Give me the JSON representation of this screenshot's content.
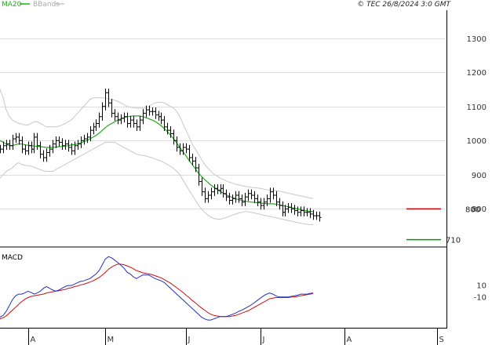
{
  "header": {
    "legend_ma": "MA20",
    "legend_bb": "BBands",
    "copyright": "© TEC 26/8/2024 3:0 GMT"
  },
  "colors": {
    "ma": "#22aa22",
    "bands": "#c8c8c8",
    "price": "#000000",
    "macd": "#2233bb",
    "signal": "#cc1111",
    "resistance": "#cc0000",
    "support": "#009900",
    "grid": "#dddddd",
    "axis": "#000000"
  },
  "chart_data": [
    {
      "type": "line",
      "panel": "price",
      "title": "",
      "ylabels": [
        "1300",
        "1200",
        "1100",
        "1000",
        "900",
        "800"
      ],
      "yticks": [
        1300,
        1200,
        1100,
        1000,
        900,
        800
      ],
      "ylim": [
        700,
        1370
      ],
      "xlim": [
        0,
        143
      ],
      "month_labels": [
        {
          "label": "A",
          "x": 9
        },
        {
          "label": "M",
          "x": 34
        },
        {
          "label": "J",
          "x": 60
        },
        {
          "label": "J",
          "x": 84
        },
        {
          "label": "A",
          "x": 111
        },
        {
          "label": "S",
          "x": 141
        }
      ],
      "close": [
        975,
        985,
        990,
        985,
        1005,
        1010,
        1000,
        975,
        970,
        985,
        975,
        1010,
        985,
        960,
        950,
        965,
        975,
        990,
        1000,
        995,
        985,
        990,
        980,
        970,
        985,
        990,
        1000,
        1005,
        1010,
        1030,
        1040,
        1050,
        1070,
        1100,
        1140,
        1110,
        1080,
        1070,
        1060,
        1065,
        1070,
        1050,
        1060,
        1050,
        1040,
        1060,
        1080,
        1090,
        1085,
        1085,
        1075,
        1070,
        1060,
        1040,
        1030,
        1020,
        1000,
        980,
        970,
        980,
        975,
        950,
        940,
        920,
        880,
        850,
        830,
        840,
        850,
        860,
        855,
        860,
        845,
        835,
        825,
        830,
        840,
        830,
        820,
        835,
        845,
        840,
        830,
        820,
        810,
        820,
        830,
        850,
        840,
        820,
        810,
        790,
        800,
        805,
        800,
        795,
        790,
        795,
        790,
        790,
        785,
        780,
        780,
        775
      ],
      "ma20": [
        1000,
        995,
        990,
        985,
        985,
        988,
        990,
        990,
        988,
        986,
        985,
        984,
        983,
        982,
        981,
        980,
        980,
        980,
        981,
        982,
        983,
        984,
        985,
        987,
        988,
        990,
        993,
        997,
        1000,
        1005,
        1010,
        1015,
        1022,
        1030,
        1038,
        1045,
        1050,
        1055,
        1060,
        1064,
        1067,
        1070,
        1071,
        1072,
        1072,
        1072,
        1070,
        1067,
        1064,
        1060,
        1056,
        1050,
        1043,
        1035,
        1026,
        1016,
        1005,
        993,
        980,
        968,
        955,
        942,
        930,
        918,
        905,
        895,
        886,
        878,
        870,
        863,
        857,
        851,
        846,
        841,
        837,
        833,
        830,
        827,
        825,
        823,
        821,
        820,
        819,
        818,
        817,
        816,
        815,
        815,
        815,
        814,
        812,
        810,
        808,
        806,
        804,
        802,
        800,
        798,
        796,
        794,
        793,
        792
      ],
      "bb_upper": [
        1150,
        1125,
        1090,
        1070,
        1060,
        1055,
        1050,
        1048,
        1046,
        1045,
        1050,
        1055,
        1055,
        1050,
        1045,
        1040,
        1040,
        1040,
        1040,
        1042,
        1045,
        1050,
        1055,
        1060,
        1070,
        1080,
        1090,
        1100,
        1110,
        1120,
        1125,
        1125,
        1125,
        1125,
        1125,
        1122,
        1120,
        1118,
        1115,
        1110,
        1105,
        1100,
        1098,
        1096,
        1095,
        1095,
        1095,
        1095,
        1100,
        1105,
        1110,
        1112,
        1112,
        1110,
        1105,
        1100,
        1095,
        1085,
        1070,
        1050,
        1030,
        1010,
        990,
        975,
        960,
        945,
        930,
        920,
        910,
        902,
        896,
        890,
        886,
        882,
        878,
        875,
        872,
        870,
        868,
        866,
        865,
        863,
        862,
        861,
        860,
        858,
        856,
        855,
        854,
        853,
        852,
        850,
        848,
        846,
        844,
        842,
        840,
        838,
        836,
        834,
        832,
        830
      ],
      "bb_lower": [
        890,
        900,
        910,
        915,
        920,
        930,
        935,
        930,
        928,
        926,
        925,
        922,
        918,
        915,
        912,
        910,
        910,
        910,
        915,
        920,
        925,
        930,
        935,
        940,
        945,
        950,
        955,
        960,
        965,
        970,
        975,
        980,
        985,
        990,
        995,
        995,
        995,
        995,
        990,
        985,
        980,
        975,
        970,
        965,
        960,
        958,
        957,
        955,
        952,
        950,
        946,
        943,
        940,
        935,
        930,
        925,
        918,
        910,
        900,
        885,
        870,
        855,
        840,
        825,
        812,
        800,
        790,
        782,
        776,
        772,
        770,
        770,
        772,
        775,
        778,
        782,
        785,
        788,
        790,
        792,
        792,
        790,
        788,
        786,
        784,
        782,
        780,
        778,
        776,
        774,
        772,
        770,
        768,
        766,
        764,
        762,
        760,
        758,
        756,
        755,
        754,
        754
      ],
      "resistance": 800,
      "support": 710,
      "resistance_label": "800",
      "support_label": "710"
    },
    {
      "type": "line",
      "panel": "macd",
      "title": "MACD",
      "ylabels": [
        "10",
        "-10"
      ],
      "yticks": [
        10,
        -10
      ],
      "ylim": [
        -58,
        70
      ],
      "xlim": [
        0,
        143
      ],
      "macd": [
        -45,
        -42,
        -35,
        -25,
        -15,
        -8,
        -5,
        -5,
        -3,
        0,
        -2,
        -5,
        -3,
        0,
        5,
        8,
        5,
        2,
        0,
        2,
        5,
        8,
        10,
        10,
        12,
        15,
        17,
        18,
        20,
        22,
        26,
        30,
        36,
        46,
        56,
        60,
        58,
        54,
        50,
        45,
        40,
        33,
        30,
        25,
        22,
        25,
        28,
        28,
        28,
        25,
        22,
        20,
        18,
        15,
        10,
        5,
        0,
        -5,
        -10,
        -15,
        -20,
        -25,
        -30,
        -35,
        -40,
        -45,
        -48,
        -50,
        -50,
        -48,
        -46,
        -44,
        -44,
        -44,
        -42,
        -40,
        -38,
        -35,
        -33,
        -30,
        -27,
        -24,
        -20,
        -16,
        -12,
        -8,
        -5,
        -3,
        -5,
        -8,
        -10,
        -10,
        -10,
        -10,
        -9,
        -8,
        -7,
        -5,
        -5,
        -5,
        -4,
        -3
      ],
      "signal": [
        -48,
        -46,
        -43,
        -38,
        -33,
        -28,
        -23,
        -18,
        -14,
        -11,
        -9,
        -8,
        -7,
        -6,
        -5,
        -3,
        -2,
        -1,
        0,
        1,
        2,
        3,
        5,
        6,
        8,
        9,
        11,
        12,
        14,
        16,
        18,
        21,
        24,
        28,
        33,
        38,
        42,
        45,
        47,
        47,
        46,
        44,
        42,
        39,
        36,
        34,
        32,
        31,
        30,
        29,
        27,
        25,
        23,
        20,
        17,
        14,
        10,
        6,
        2,
        -2,
        -7,
        -11,
        -16,
        -20,
        -25,
        -29,
        -33,
        -37,
        -40,
        -42,
        -43,
        -44,
        -44,
        -44,
        -44,
        -43,
        -42,
        -40,
        -38,
        -36,
        -34,
        -31,
        -28,
        -25,
        -22,
        -19,
        -16,
        -13,
        -12,
        -11,
        -11,
        -11,
        -11,
        -11,
        -10,
        -10,
        -9,
        -8,
        -7,
        -6,
        -5,
        -4
      ]
    }
  ]
}
